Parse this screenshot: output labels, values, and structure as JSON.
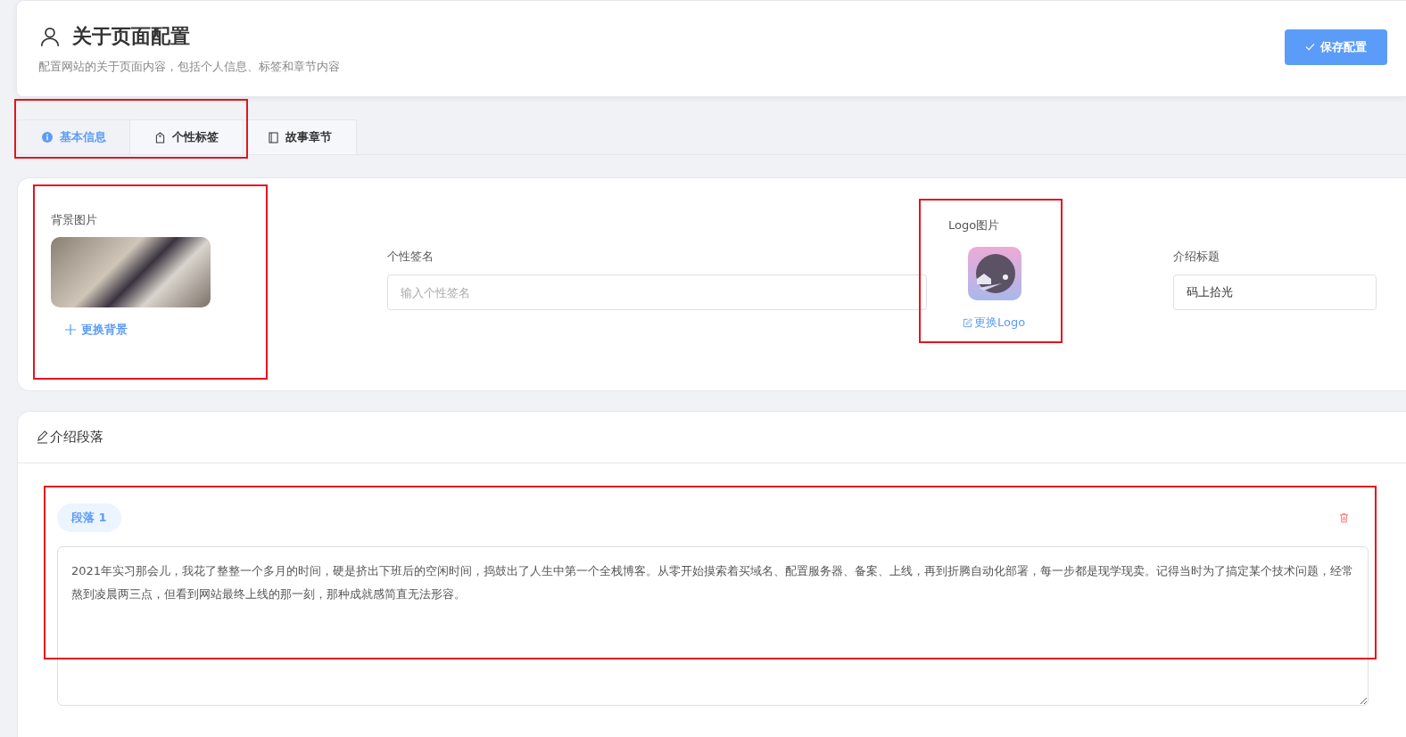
{
  "header": {
    "title": "关于页面配置",
    "subtitle": "配置网站的关于页面内容，包括个人信息、标签和章节内容",
    "save_button": "保存配置"
  },
  "tabs": [
    {
      "label": "基本信息",
      "kind": "info",
      "selected": true
    },
    {
      "label": "个性标签",
      "kind": "tag",
      "selected": false
    },
    {
      "label": "故事章节",
      "kind": "book",
      "selected": false
    }
  ],
  "basic": {
    "background": {
      "label": "背景图片",
      "change": "更换背景"
    },
    "signature": {
      "label": "个性签名",
      "placeholder": "输入个性签名"
    },
    "logo": {
      "label": "Logo图片",
      "change": "更换Logo"
    },
    "intro_title": {
      "label": "介绍标题",
      "value": "码上拾光"
    }
  },
  "paragraphs": {
    "title": "介绍段落",
    "items": [
      {
        "badge": "段落 1",
        "text": "2021年实习那会儿，我花了整整一个多月的时间，硬是挤出下班后的空闲时间，捣鼓出了人生中第一个全栈博客。从零开始摸索着买域名、配置服务器、备案、上线，再到折腾自动化部署，每一步都是现学现卖。记得当时为了搞定某个技术问题，经常熬到凌晨两三点，但看到网站最终上线的那一刻，那种成就感简直无法形容。"
      }
    ]
  }
}
